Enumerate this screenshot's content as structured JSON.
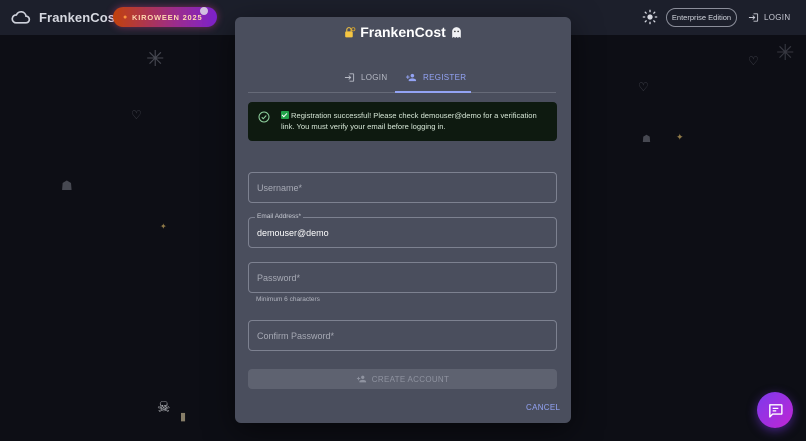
{
  "appbar": {
    "brand": "FrankenCost",
    "badge": "KIROWEEN 2025",
    "edition": "Enterprise Edition",
    "login_label": "LOGIN"
  },
  "dialog": {
    "title": "FrankenCost",
    "tabs": [
      {
        "label": "LOGIN",
        "active": false
      },
      {
        "label": "REGISTER",
        "active": true
      }
    ],
    "alert": {
      "message": "Registration successful! Please check demouser@demo for a verification link. You must verify your email before logging in."
    },
    "fields": {
      "username": {
        "placeholder": "Username",
        "required": "*",
        "value": ""
      },
      "email": {
        "label": "Email Address",
        "required": "*",
        "value": "demouser@demo"
      },
      "password": {
        "placeholder": "Password",
        "required": "*",
        "helper": "Minimum 6 characters",
        "value": ""
      },
      "confirm": {
        "placeholder": "Confirm Password",
        "required": "*",
        "value": ""
      }
    },
    "create_label": "CREATE ACCOUNT",
    "cancel_label": "CANCEL"
  },
  "colors": {
    "accent": "#93a3f4",
    "success": "#22a34a",
    "dialog_bg": "#4a4e5d",
    "page_bg": "#0d0e15"
  },
  "icons": {
    "brand": "cloud-icon",
    "theme": "sun-icon",
    "login": "login-icon",
    "register": "person-add-icon",
    "alert": "check-circle-icon",
    "chat": "chat-icon"
  }
}
